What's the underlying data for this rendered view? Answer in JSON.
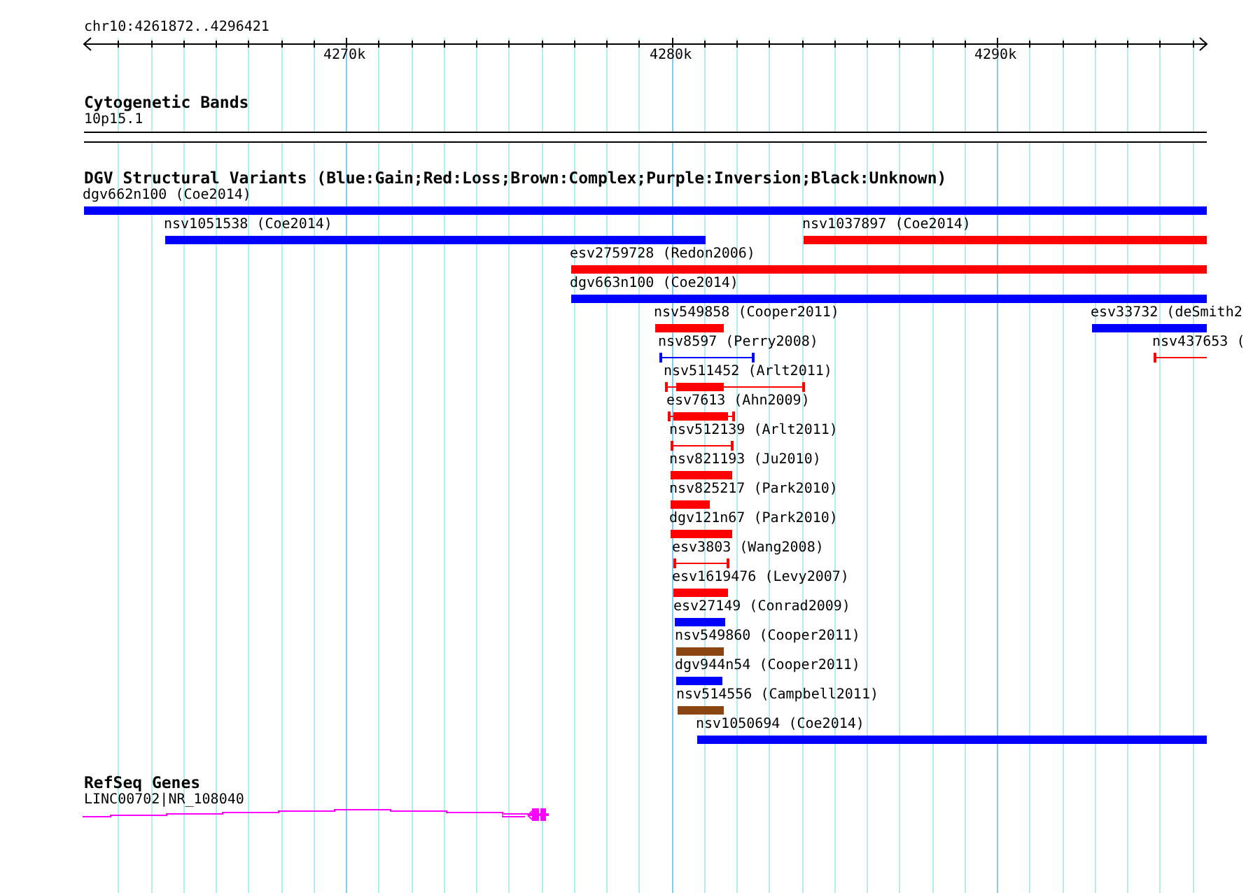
{
  "ruler": {
    "range": "chr10:4261872..4296421",
    "ticks": [
      "4270k",
      "4280k",
      "4290k"
    ]
  },
  "tracks": [
    {
      "kind": "bands",
      "title": "Cytogenetic Bands",
      "features": [
        {
          "label": "10p15.1"
        }
      ]
    },
    {
      "kind": "variants",
      "title": "DGV Structural Variants (Blue:Gain;Red:Loss;Brown:Complex;Purple:Inversion;Black:Unknown)",
      "features": [
        {
          "label": "dgv662n100 (Coe2014)",
          "kind": "bar",
          "color": "#0000ff"
        },
        {
          "label": "nsv1051538 (Coe2014)",
          "kind": "bar",
          "color": "#0000ff"
        },
        {
          "label": "nsv1037897 (Coe2014)",
          "kind": "bar",
          "color": "#ff0000"
        },
        {
          "label": "esv2759728 (Redon2006)",
          "kind": "bar",
          "color": "#ff0000"
        },
        {
          "label": "dgv663n100 (Coe2014)",
          "kind": "bar",
          "color": "#0000ff"
        },
        {
          "label": "nsv549858 (Cooper2011)",
          "kind": "bar",
          "color": "#ff0000"
        },
        {
          "label": "esv33732 (deSmith2",
          "kind": "bar",
          "color": "#0000ff"
        },
        {
          "label": "nsv8597 (Perry2008)",
          "kind": "range",
          "color": "#0000ff"
        },
        {
          "label": "nsv437653 (",
          "kind": "range",
          "color": "#ff0000"
        },
        {
          "label": "nsv511452 (Arlt2011)",
          "kind": "bar_range",
          "color": "#ff0000"
        },
        {
          "label": "esv7613 (Ahn2009)",
          "kind": "bar_range",
          "color": "#ff0000"
        },
        {
          "label": "nsv512139 (Arlt2011)",
          "kind": "range",
          "color": "#ff0000"
        },
        {
          "label": "nsv821193 (Ju2010)",
          "kind": "bar",
          "color": "#ff0000"
        },
        {
          "label": "nsv825217 (Park2010)",
          "kind": "bar",
          "color": "#ff0000"
        },
        {
          "label": "dgv121n67 (Park2010)",
          "kind": "bar",
          "color": "#ff0000"
        },
        {
          "label": "esv3803 (Wang2008)",
          "kind": "range",
          "color": "#ff0000"
        },
        {
          "label": "esv1619476 (Levy2007)",
          "kind": "bar",
          "color": "#ff0000"
        },
        {
          "label": "esv27149 (Conrad2009)",
          "kind": "bar",
          "color": "#0000ff"
        },
        {
          "label": "nsv549860 (Cooper2011)",
          "kind": "bar",
          "color": "#8b4513"
        },
        {
          "label": "dgv944n54 (Cooper2011)",
          "kind": "bar",
          "color": "#0000ff"
        },
        {
          "label": "nsv514556 (Campbell2011)",
          "kind": "bar",
          "color": "#8b4513"
        },
        {
          "label": "nsv1050694 (Coe2014)",
          "kind": "bar",
          "color": "#0000ff"
        }
      ]
    },
    {
      "kind": "genes",
      "title": "RefSeq Genes",
      "features": [
        {
          "label": "LINC00702|NR_108040"
        }
      ]
    }
  ]
}
